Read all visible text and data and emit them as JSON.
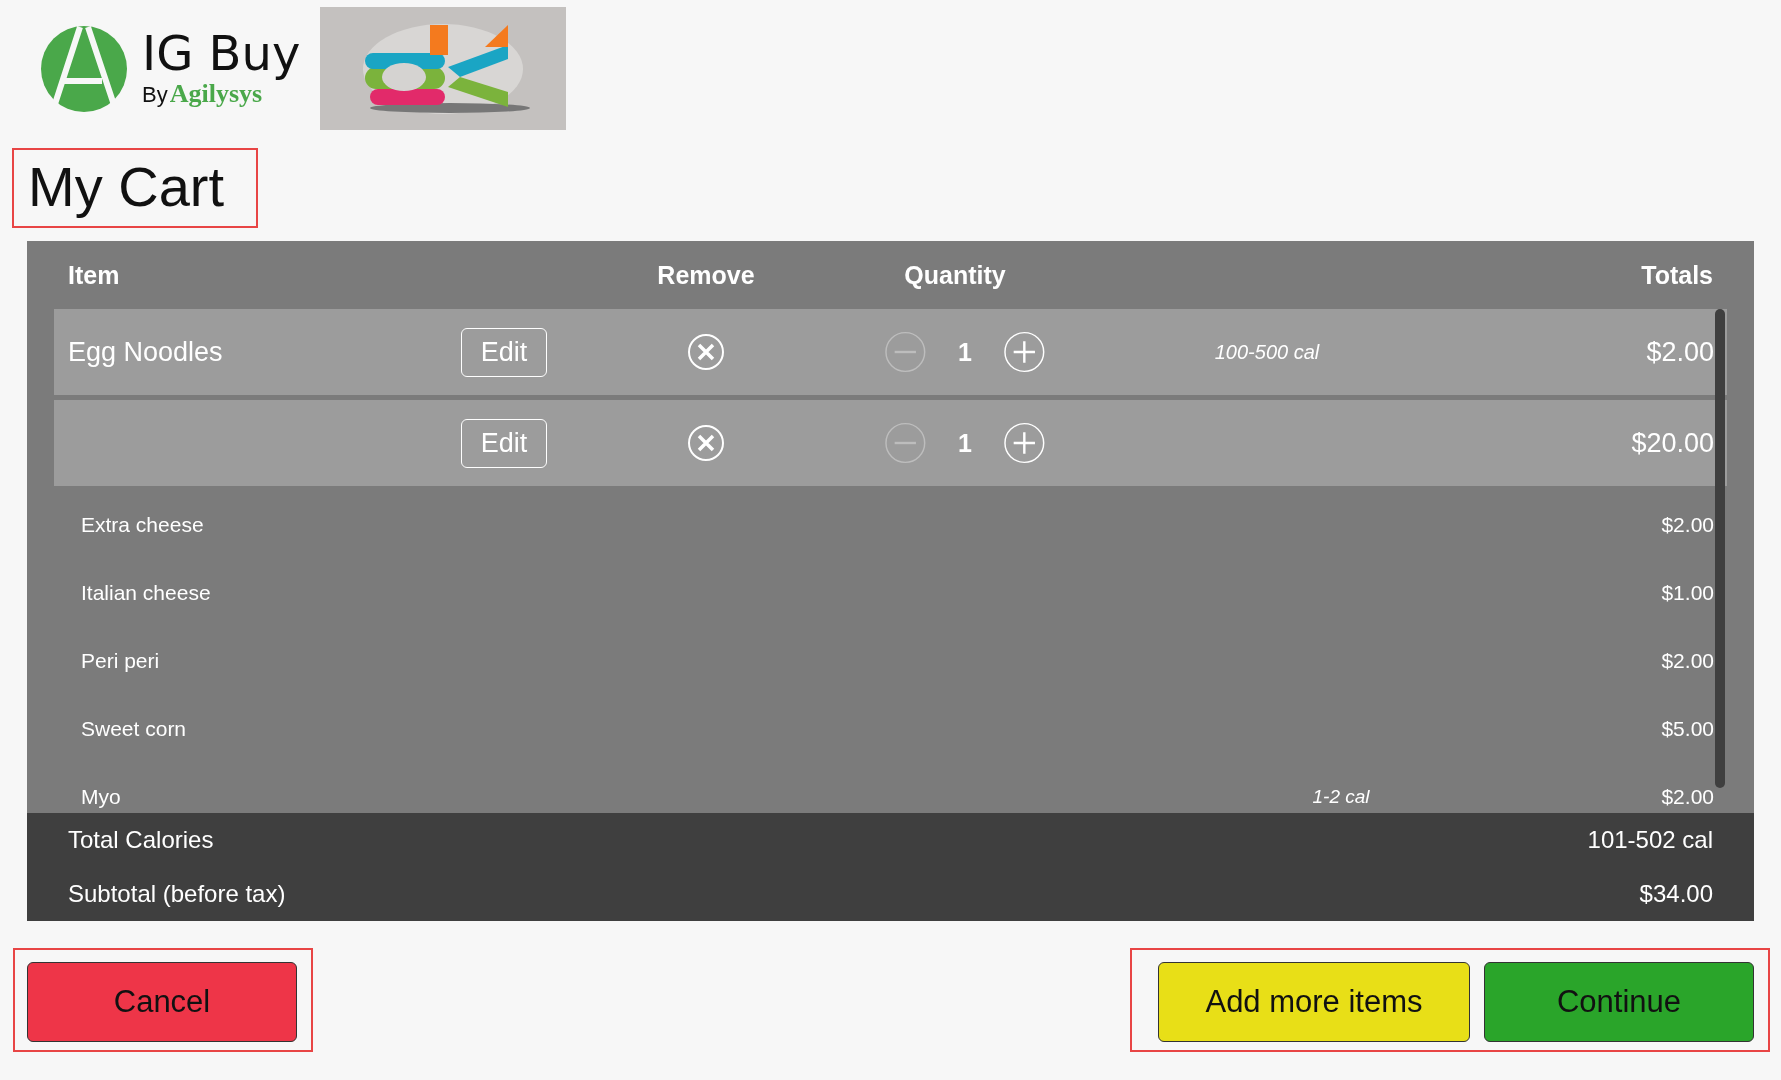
{
  "brand": {
    "name": "IG Buy",
    "by": "By",
    "company": "Agilysys"
  },
  "title": "My Cart",
  "table": {
    "columns": [
      {
        "label": "Item"
      },
      {
        "label": "Remove"
      },
      {
        "label": "Quantity"
      },
      {
        "label": "Totals"
      }
    ],
    "items": [
      {
        "name": "Egg Noodles",
        "edit": "Edit",
        "quantity": "1",
        "can_decrease": false,
        "calories": "100-500 cal",
        "total": "$2.00"
      },
      {
        "edit": "Edit",
        "quantity": "1",
        "can_decrease": false,
        "total": "$20.00"
      }
    ],
    "modifiers": [
      {
        "name": "Extra cheese",
        "price": "$2.00"
      },
      {
        "name": "Italian cheese",
        "price": "$1.00"
      },
      {
        "name": "Peri peri",
        "price": "$2.00"
      },
      {
        "name": "Sweet corn",
        "price": "$5.00"
      },
      {
        "name": "Myo",
        "calories": "1-2 cal",
        "price": "$2.00"
      }
    ]
  },
  "summary": [
    {
      "label": "Total Calories",
      "value": "101-502 cal"
    },
    {
      "label": "Subtotal (before tax)",
      "value": "$34.00"
    }
  ],
  "buttons": [
    {
      "label": "Cancel",
      "kind": "cancel"
    },
    {
      "label": "Add more items",
      "kind": "secondary"
    },
    {
      "label": "Continue",
      "kind": "primary"
    }
  ]
}
